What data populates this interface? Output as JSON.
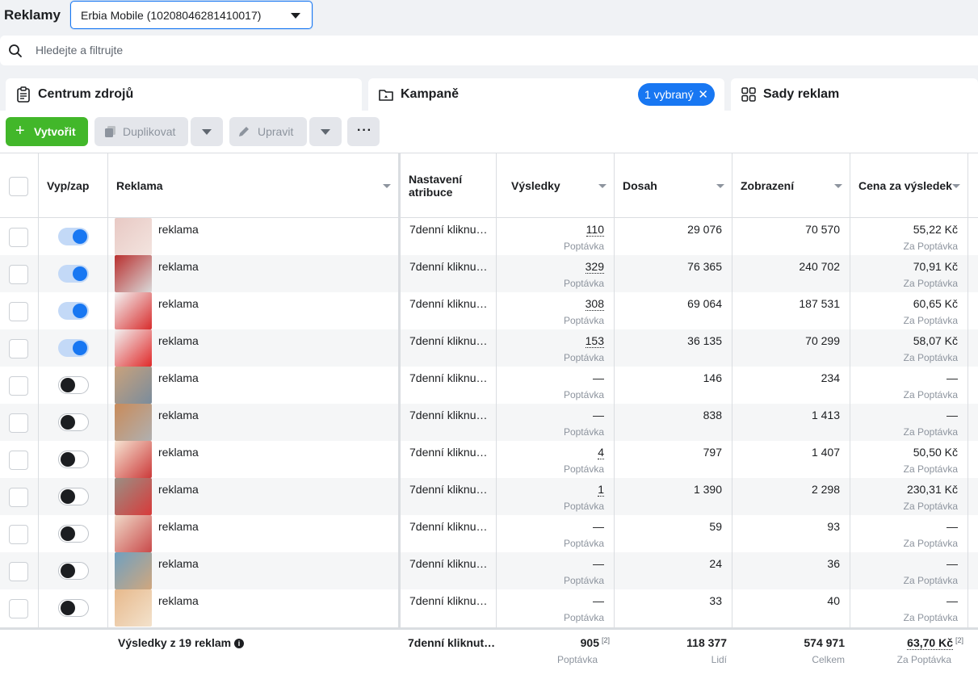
{
  "app": {
    "title": "Reklamy"
  },
  "account": {
    "selected": "Erbia Mobile (10208046281410017)"
  },
  "search": {
    "placeholder": "Hledejte a filtrujte"
  },
  "tabs": [
    {
      "label": "Centrum zdrojů"
    },
    {
      "label": "Kampaně",
      "chip": "1 vybraný"
    },
    {
      "label": "Sady reklam"
    }
  ],
  "toolbar": {
    "create_label": "Vytvořit",
    "duplicate_label": "Duplikovat",
    "edit_label": "Upravit",
    "more_label": "···"
  },
  "columns": {
    "toggle": "Vyp/zap",
    "ad": "Reklama",
    "attribution": "Nastavení atribuce",
    "results": "Výsledky",
    "reach": "Dosah",
    "impressions": "Zobrazení",
    "cpr": "Cena za výsledek"
  },
  "rows": [
    {
      "on": true,
      "name": "reklama",
      "attribution": "7denní kliknu…",
      "results": "110",
      "results_sub": "Poptávka",
      "reach": "29 076",
      "impressions": "70 570",
      "cpr": "55,22 Kč",
      "cpr_sub": "Za Poptávka"
    },
    {
      "on": true,
      "name": "reklama",
      "attribution": "7denní kliknu…",
      "results": "329",
      "results_sub": "Poptávka",
      "reach": "76 365",
      "impressions": "240 702",
      "cpr": "70,91 Kč",
      "cpr_sub": "Za Poptávka"
    },
    {
      "on": true,
      "name": "reklama",
      "attribution": "7denní kliknu…",
      "results": "308",
      "results_sub": "Poptávka",
      "reach": "69 064",
      "impressions": "187 531",
      "cpr": "60,65 Kč",
      "cpr_sub": "Za Poptávka"
    },
    {
      "on": true,
      "name": "reklama",
      "attribution": "7denní kliknu…",
      "results": "153",
      "results_sub": "Poptávka",
      "reach": "36 135",
      "impressions": "70 299",
      "cpr": "58,07 Kč",
      "cpr_sub": "Za Poptávka"
    },
    {
      "on": false,
      "name": "reklama",
      "attribution": "7denní kliknu…",
      "results": "—",
      "results_sub": "Poptávka",
      "reach": "146",
      "impressions": "234",
      "cpr": "—",
      "cpr_sub": "Za Poptávka"
    },
    {
      "on": false,
      "name": "reklama",
      "attribution": "7denní kliknu…",
      "results": "—",
      "results_sub": "Poptávka",
      "reach": "838",
      "impressions": "1 413",
      "cpr": "—",
      "cpr_sub": "Za Poptávka"
    },
    {
      "on": false,
      "name": "reklama",
      "attribution": "7denní kliknu…",
      "results": "4",
      "results_sub": "Poptávka",
      "reach": "797",
      "impressions": "1 407",
      "cpr": "50,50 Kč",
      "cpr_sub": "Za Poptávka"
    },
    {
      "on": false,
      "name": "reklama",
      "attribution": "7denní kliknu…",
      "results": "1",
      "results_sub": "Poptávka",
      "reach": "1 390",
      "impressions": "2 298",
      "cpr": "230,31 Kč",
      "cpr_sub": "Za Poptávka"
    },
    {
      "on": false,
      "name": "reklama",
      "attribution": "7denní kliknu…",
      "results": "—",
      "results_sub": "Poptávka",
      "reach": "59",
      "impressions": "93",
      "cpr": "—",
      "cpr_sub": "Za Poptávka"
    },
    {
      "on": false,
      "name": "reklama",
      "attribution": "7denní kliknu…",
      "results": "—",
      "results_sub": "Poptávka",
      "reach": "24",
      "impressions": "36",
      "cpr": "—",
      "cpr_sub": "Za Poptávka"
    },
    {
      "on": false,
      "name": "reklama",
      "attribution": "7denní kliknu…",
      "results": "—",
      "results_sub": "Poptávka",
      "reach": "33",
      "impressions": "40",
      "cpr": "—",
      "cpr_sub": "Za Poptávka"
    }
  ],
  "footer": {
    "label": "Výsledky z 19 reklam",
    "attribution": "7denní kliknut…",
    "results": "905",
    "results_sup": "[2]",
    "results_sub": "Poptávka",
    "reach": "118 377",
    "reach_sub": "Lidí",
    "impressions": "574 971",
    "impressions_sub": "Celkem",
    "cpr": "63,70 Kč",
    "cpr_sup": "[2]",
    "cpr_sub": "Za Poptávka"
  },
  "colors": {
    "accent": "#1877f2",
    "create": "#42b72a",
    "toggle_track_on": "#c3d9f7"
  }
}
